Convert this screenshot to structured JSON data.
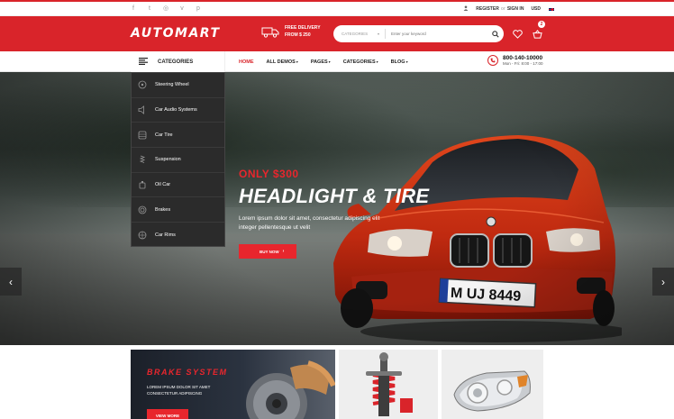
{
  "topbar": {
    "social_icons": [
      "facebook-icon",
      "twitter-icon",
      "instagram-icon",
      "vimeo-icon",
      "pinterest-icon"
    ],
    "register_label": "REGISTER",
    "or_label": "or",
    "signin_label": "SIGN IN",
    "currency": "USD",
    "language_flag": "uk-flag-icon"
  },
  "header": {
    "logo": "AUTOMART",
    "delivery_line1": "FREE DELIVERY",
    "delivery_line2": "FROM $ 250",
    "search_category": "CATEGORIES",
    "search_placeholder": "Enter your keyword",
    "cart_count": "2"
  },
  "nav": {
    "categories_label": "CATEGORIES",
    "items": [
      {
        "label": "HOME",
        "caret": ""
      },
      {
        "label": "ALL DEMOS",
        "caret": "▾"
      },
      {
        "label": "PAGES",
        "caret": "▾"
      },
      {
        "label": "CATEGORIES",
        "caret": "▾"
      },
      {
        "label": "BLOG",
        "caret": "▾"
      }
    ],
    "phone": "800-140-10000",
    "hours": "Mon - Fri: 8:00 - 17:00"
  },
  "categories": [
    {
      "label": "Steering Wheel",
      "icon": "steering-wheel-icon"
    },
    {
      "label": "Car Audio Systems",
      "icon": "speaker-icon"
    },
    {
      "label": "Car Tire",
      "icon": "tire-icon"
    },
    {
      "label": "Suspension",
      "icon": "suspension-icon"
    },
    {
      "label": "Oil Car",
      "icon": "oil-can-icon"
    },
    {
      "label": "Brakes",
      "icon": "brake-icon"
    },
    {
      "label": "Car Rims",
      "icon": "rim-icon"
    }
  ],
  "hero": {
    "subtitle": "ONLY $300",
    "title": "HEADLIGHT & TIRE",
    "description": "Lorem ipsum dolor sit amet, consectetur adipiscing elit integer pellentesque ut velit",
    "button": "BUY NOW",
    "plate": "M UJ 8449"
  },
  "banners": {
    "brake_title": "BRAKE SYSTEM",
    "brake_desc": "LOREM IPSUM DOLOR SIT AMET CONSECTETUR ADIPISCING",
    "brake_button": "VIEW MORE"
  },
  "colors": {
    "accent": "#d9242a",
    "dark": "#2b2b2b"
  }
}
